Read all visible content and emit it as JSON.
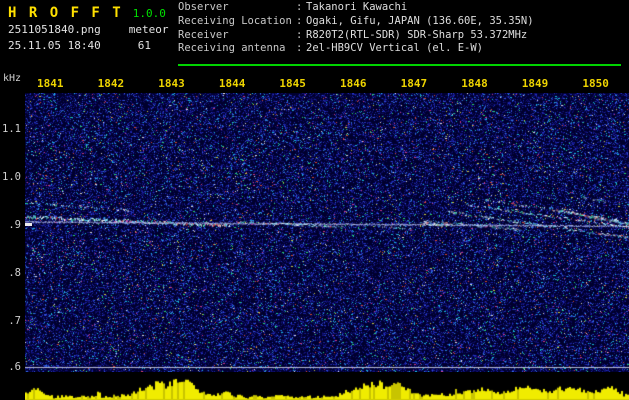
{
  "header": {
    "app_title": "H R O F F T",
    "version": "1.0.0",
    "filename": "2511051840.png",
    "mode": "meteor",
    "datetime": "25.11.05 18:40",
    "count": "61",
    "colon": ":",
    "info": [
      {
        "label": "Observer",
        "value": "Takanori Kawachi"
      },
      {
        "label": "Receiving Location",
        "value": "Ogaki, Gifu, JAPAN (136.60E, 35.35N)"
      },
      {
        "label": "Receiver",
        "value": "R820T2(RTL-SDR) SDR-Sharp 53.372MHz"
      },
      {
        "label": "Receiving antenna",
        "value": "2el-HB9CV Vertical (el. E-W)"
      }
    ]
  },
  "spectrogram": {
    "type": "spectrogram",
    "y_unit": "kHz",
    "freq_ticks": [
      "1.1",
      "1.0",
      ".9",
      ".8",
      ".7",
      ".6"
    ],
    "freq_tick_values": [
      1.1,
      1.0,
      0.9,
      0.8,
      0.7,
      0.6
    ],
    "time_ticks": [
      "1841",
      "1842",
      "1843",
      "1844",
      "1845",
      "1846",
      "1847",
      "1848",
      "1849",
      "1850"
    ],
    "freq_range_khz": [
      0.59,
      1.17
    ],
    "marker_freq_khz": 0.9,
    "gridline_freq_khz": 0.6,
    "colors": {
      "bg": "#00002e",
      "gridline": "#b8bcd8",
      "time_label": "#eed400",
      "level_bar": "#f0ec00",
      "accent_green": "#00d400"
    },
    "noise_density": 0.42,
    "noise_palette": [
      {
        "c": "#0b0b5e",
        "w": 0.3
      },
      {
        "c": "#12127e",
        "w": 0.22
      },
      {
        "c": "#1a22a2",
        "w": 0.16
      },
      {
        "c": "#2433c4",
        "w": 0.1
      },
      {
        "c": "#3350e0",
        "w": 0.07
      },
      {
        "c": "#2c7fd8",
        "w": 0.05
      },
      {
        "c": "#18bce0",
        "w": 0.035
      },
      {
        "c": "#28d870",
        "w": 0.015
      },
      {
        "c": "#cc3a8c",
        "w": 0.012
      },
      {
        "c": "#d84a33",
        "w": 0.01
      },
      {
        "c": "#cccc44",
        "w": 0.008
      },
      {
        "c": "#e0e0e0",
        "w": 0.01
      }
    ],
    "trace_palette": [
      "#58e8ff",
      "#9ef4ff",
      "#e8ffff",
      "#46e0a0",
      "#88c0ff",
      "#ffffff"
    ],
    "carrier_palette": [
      "#8890cc",
      "#9aa4dc",
      "#b8c0ea"
    ],
    "red_palette": [
      "#e84848",
      "#e858b8",
      "#ff8858"
    ],
    "traces": [
      {
        "x1": 0.0,
        "x2": 0.34,
        "f1": 0.916,
        "f2": 0.898,
        "strength": "strong",
        "red": 0.22,
        "spread": 2.6
      },
      {
        "x1": 0.01,
        "x2": 0.17,
        "f1": 0.944,
        "f2": 0.93,
        "strength": "faint",
        "red": 0.05,
        "spread": 2.0
      },
      {
        "x1": 0.0,
        "x2": 1.0,
        "f1": 0.905,
        "f2": 0.896,
        "strength": "line",
        "red": 0.02,
        "spread": 1.2
      },
      {
        "x1": 0.35,
        "x2": 0.53,
        "f1": 0.906,
        "f2": 0.894,
        "strength": "medium",
        "red": 0.1,
        "spread": 2.2
      },
      {
        "x1": 0.55,
        "x2": 0.64,
        "f1": 0.898,
        "f2": 0.89,
        "strength": "faint",
        "red": 0.04,
        "spread": 1.8
      },
      {
        "x1": 0.655,
        "x2": 0.7,
        "f1": 0.902,
        "f2": 0.899,
        "strength": "strong",
        "red": 0.18,
        "spread": 2.4
      },
      {
        "x1": 0.66,
        "x2": 0.82,
        "f1": 0.907,
        "f2": 0.889,
        "strength": "medium",
        "red": 0.12,
        "spread": 2.2
      },
      {
        "x1": 0.7,
        "x2": 1.0,
        "f1": 0.926,
        "f2": 0.872,
        "strength": "medium",
        "red": 0.15,
        "spread": 2.4
      },
      {
        "x1": 0.73,
        "x2": 1.0,
        "f1": 0.941,
        "f2": 0.894,
        "strength": "medium",
        "red": 0.12,
        "spread": 2.2
      },
      {
        "x1": 0.76,
        "x2": 0.98,
        "f1": 0.951,
        "f2": 0.91,
        "strength": "faint",
        "red": 0.08,
        "spread": 2.0
      },
      {
        "x1": 0.88,
        "x2": 1.0,
        "f1": 0.93,
        "f2": 0.901,
        "strength": "strong",
        "red": 0.15,
        "spread": 2.2
      },
      {
        "x1": 0.92,
        "x2": 1.0,
        "f1": 0.957,
        "f2": 0.938,
        "strength": "faint",
        "red": 0.06,
        "spread": 1.8
      }
    ],
    "level_bumps": [
      {
        "c": 0.015,
        "h": 9,
        "w": 0.01
      },
      {
        "c": 0.225,
        "h": 17,
        "w": 0.03
      },
      {
        "c": 0.27,
        "h": 12,
        "w": 0.015
      },
      {
        "c": 0.33,
        "h": 6,
        "w": 0.01
      },
      {
        "c": 0.575,
        "h": 15,
        "w": 0.03
      },
      {
        "c": 0.62,
        "h": 9,
        "w": 0.012
      },
      {
        "c": 0.75,
        "h": 6,
        "w": 0.02
      },
      {
        "c": 0.83,
        "h": 7,
        "w": 0.02
      },
      {
        "c": 0.85,
        "h": 4,
        "w": 0.13
      },
      {
        "c": 0.9,
        "h": 8,
        "w": 0.02
      },
      {
        "c": 0.965,
        "h": 9,
        "w": 0.012
      }
    ]
  }
}
